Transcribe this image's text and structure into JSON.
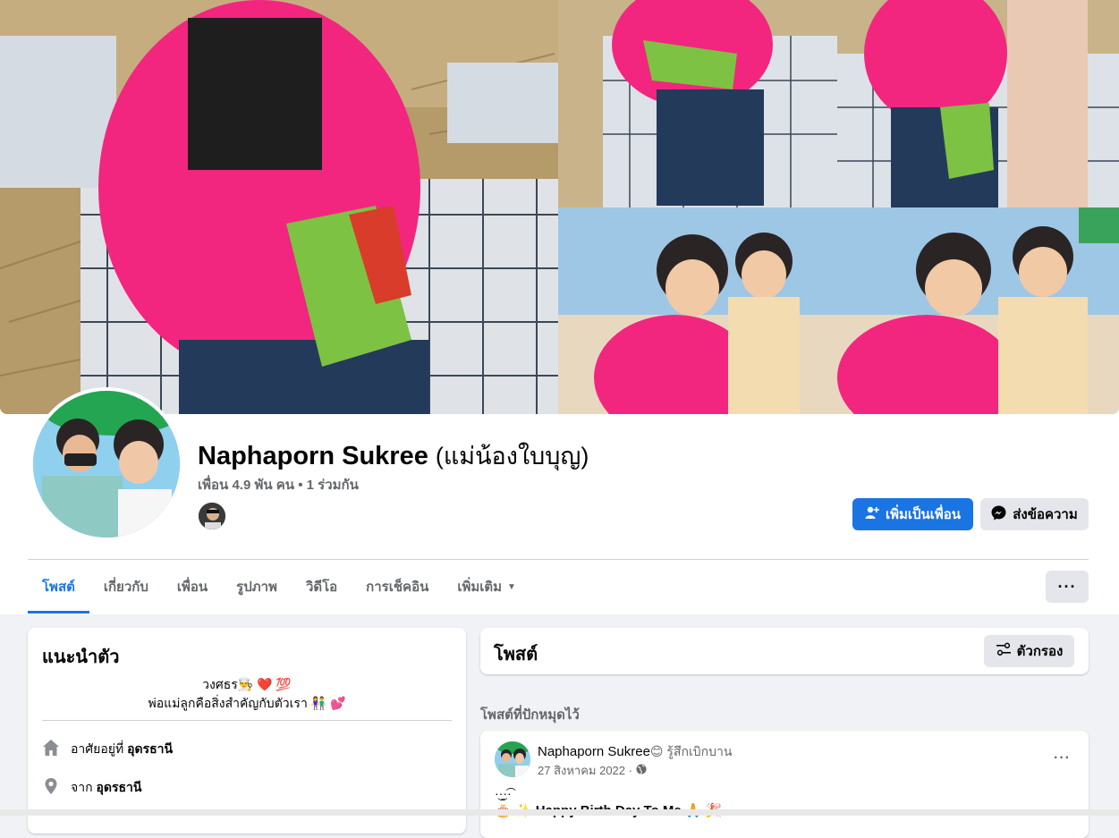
{
  "profile": {
    "name": "Naphaporn Sukree",
    "alt_name": "(แม่น้องใบบุญ)",
    "friends_line": "เพื่อน 4.9 พัน คน • 1 ร่วมกัน"
  },
  "actions": {
    "add_friend_label": "เพิ่มเป็นเพื่อน",
    "message_label": "ส่งข้อความ"
  },
  "tabs": [
    {
      "label": "โพสต์",
      "active": true
    },
    {
      "label": "เกี่ยวกับ"
    },
    {
      "label": "เพื่อน"
    },
    {
      "label": "รูปภาพ"
    },
    {
      "label": "วิดีโอ"
    },
    {
      "label": "การเช็คอิน"
    },
    {
      "label": "เพิ่มเติม"
    }
  ],
  "intro": {
    "title": "แนะนำตัว",
    "bio_line1": "วงศธร👨‍🍳 ❤️ 💯",
    "bio_line2": "พ่อแม่ลูกคือสิ่งสำคัญกับตัวเรา 👫 💕",
    "lives_in_prefix": "อาศัยอยู่ที่",
    "lives_in_place": "อุดรธานี",
    "from_prefix": "จาก",
    "from_place": "อุดรธานี"
  },
  "posts": {
    "title": "โพสต์",
    "filter_label": "ตัวกรอง",
    "pinned_label": "โพสต์ที่ปักหมุดไว้"
  },
  "post": {
    "author": "Naphaporn Sukree",
    "feeling": "😊 รู้สึกเบิกบาน",
    "date": "27 สิงหาคม 2022 ·",
    "text1": "·͜·̮·͡·",
    "text2": "🎂 ✨ Happy Birth Day To Me 🙏 🎉"
  },
  "colors": {
    "accent": "#1b74e4",
    "jacket_pink": "#f2267f",
    "page_bg": "#f0f2f5"
  }
}
